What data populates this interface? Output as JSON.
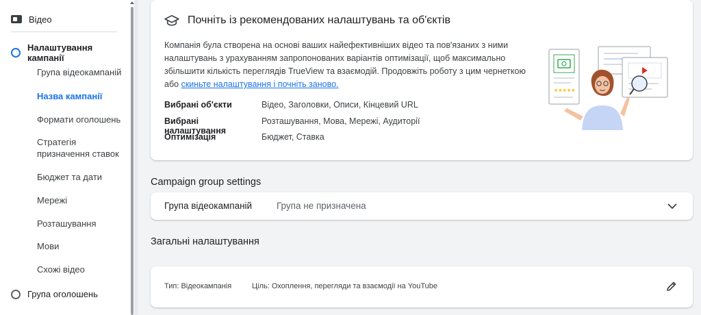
{
  "sidebar": {
    "video_label": "Відео",
    "campaign_settings_label": "Налаштування кампанії",
    "sub_items": [
      "Група відеокампаній",
      "Назва кампанії",
      "Формати оголошень",
      "Стратегія призначення ставок",
      "Бюджет та дати",
      "Мережі",
      "Розташування",
      "Мови",
      "Схожі відео"
    ],
    "active_sub_item": "Назва кампанії",
    "ad_group_label": "Група оголошень"
  },
  "recommendation": {
    "title": "Почніть із рекомендованих налаштувань та об'єктів",
    "description": "Компанія була створена на основі ваших найефективніших відео та пов'язаних з ними налаштувань з урахуванням запропонованих варіантів оптимізації, щоб максимально збільшити кількість переглядів TrueView та взаємодій. Продовжіть роботу з цим чернеткою або",
    "link_text": "скиньте налаштування і почніть заново.",
    "rows": [
      {
        "label": "Вибрані об'єкти",
        "value": "Відео, Заголовки, Описи, Кінцевий URL"
      },
      {
        "label": "Вибрані налаштування",
        "value": "Розташування, Мова, Мережі, Аудиторії"
      },
      {
        "label": "Оптимізація",
        "value": "Бюджет, Ставка"
      }
    ]
  },
  "campaign_group": {
    "heading": "Campaign group settings",
    "label": "Група відеокампаній",
    "value": "Група не призначена"
  },
  "general": {
    "heading": "Загальні налаштування",
    "type": "Тип: Відеокампанія",
    "goal": "Ціль: Охоплення, перегляди та взаємодії на YouTube"
  },
  "colors": {
    "accent": "#1a73e8",
    "background": "#f1f3f4"
  }
}
